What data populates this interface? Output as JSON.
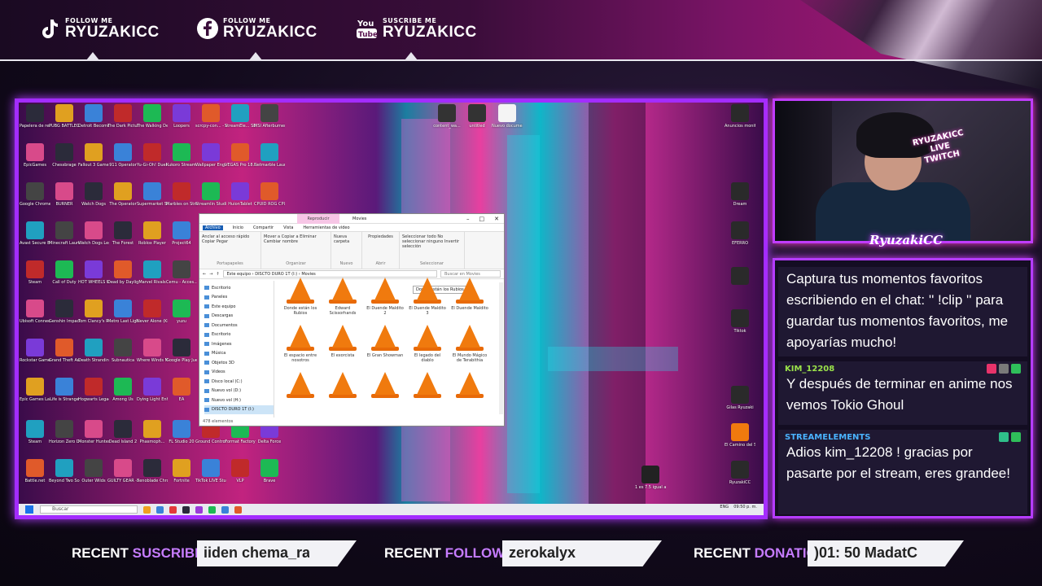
{
  "socials": [
    {
      "icon": "tiktok-icon",
      "label_small": "FOLLOW ME",
      "label_big": "RYUZAKICC"
    },
    {
      "icon": "facebook-icon",
      "label_small": "FOLLOW ME",
      "label_big": "RYUZAKICC"
    },
    {
      "icon": "youtube-icon",
      "label_small": "SUSCRIBE ME",
      "label_big": "RYUZAKICC"
    }
  ],
  "desktop": {
    "icons": [
      "Papelera de reciclaje",
      "PUBG BATTLEGR...",
      "Detroit Become...",
      "The Dark Pictures...",
      "The Walking Dead The...",
      "Loopers",
      "scrcpy-con... - Acceso di...",
      "StreamEle... SE.Live",
      "MSI Afterburner",
      "EpicGames",
      "Chessbrage",
      "Fallout 3 Game of t...",
      "911 Operator",
      "Yu-Gi-Oh! Duel Links",
      "Kukoro Stream ch...",
      "Wallpaper Engine",
      "VEGAS Pro 18.0",
      "Netmarble Launcher",
      "Google Chrome",
      "BURNER",
      "Watch Dogs",
      "The Operator",
      "Supermarket Simulator",
      "Marbles on Stream",
      "Streamlin Studio",
      "HuionTablet",
      "CPUID ROG CPU-Z",
      "Avast Secure Browser",
      "Minecraft Launcher",
      "Watch Dogs Legion",
      "The Forest",
      "Roblox Player",
      "Project64",
      "Steam",
      "Call of Duty",
      "HOT WHEELS UNLEASHED",
      "Dead by Daylight",
      "Marvel Rivals",
      "Cemu - Acces...",
      "Ubisoft Connect",
      "Genshin Impact",
      "Tom Clancy's Rainbow Si...",
      "Metro Last Light Redux",
      "Never Alone (Kisima In...",
      "yuzu",
      "Rockstar Games",
      "Grand Theft Auto V",
      "Death Stranding",
      "Subnautica",
      "Where Winds Meet",
      "Google Play Juegos",
      "Epic Games Launcher",
      "Life is Strange",
      "Hogwarts Legacy",
      "Among Us",
      "Dying Light Enhanced...",
      "EA",
      "Steam",
      "Horizon Zero Dawn",
      "Monster Hunter World",
      "Dead Island 2",
      "Phasmoph...",
      "FL Studio 20",
      "Ground Control",
      "Format Factory",
      "Delta Force",
      "Battle.net",
      "Beyond Two Souls",
      "Outer Wilds",
      "GUILTY GEAR -STRIVE-",
      "Xenoblade Chronicl...",
      "Fortnite",
      "TikTok LIVE Studio",
      "VLP",
      "Brave"
    ],
    "top_icons": [
      "content_wa...",
      "untitled",
      "Nuevo documen..."
    ],
    "right_icons": [
      "Anuncios monitor",
      "Dream",
      "EFERRO",
      "",
      "Tiktok",
      "Gilas Ryuzaki",
      "El Camino del Streamer",
      "RyuzakiCC"
    ],
    "folder_icon": "1 es 7.5 igual a 0.125 d 0...",
    "taskbar": {
      "search_placeholder": "Buscar",
      "lang": "ENG",
      "time": "09:50 p. m."
    }
  },
  "explorer": {
    "contextual_tab": "Reproducir",
    "title": "Movies",
    "tabs": [
      "Archivo",
      "Inicio",
      "Compartir",
      "Vista",
      "Herramientas de video"
    ],
    "ribbon_groups": [
      {
        "buttons": "Anclar al acceso rápido  Copiar  Pegar",
        "label": "Portapapeles"
      },
      {
        "buttons": "Mover a  Copiar a  Eliminar  Cambiar nombre",
        "label": "Organizar"
      },
      {
        "buttons": "Nueva carpeta",
        "label": "Nuevo"
      },
      {
        "buttons": "Propiedades",
        "label": "Abrir"
      },
      {
        "buttons": "Seleccionar todo  No seleccionar ninguno  Invertir selección",
        "label": "Seleccionar"
      }
    ],
    "path": "Este equipo  ›  DISCTO DURO 1T (I:)  ›  Movies",
    "search_placeholder": "Buscar en Movies",
    "nav": [
      "Escritorio",
      "Paneles",
      "Este equipo",
      "Descargas",
      "Documentos",
      "Escritorio",
      "Imágenes",
      "Música",
      "Objetos 3D",
      "Videos",
      "Disco local (C:)",
      "Nuevo vol (D:)",
      "Nuevo vol (H:)",
      "DISCTO DURO 1T (I:)"
    ],
    "files": [
      "Donde están los Rubios",
      "Edward Scissorhands",
      "El Duende Maldito 2",
      "El Duende Maldito 3",
      "El Duende Maldito",
      "El espacio entre nosotros",
      "El exorcista",
      "El Gran Showman",
      "El legado del diablo",
      "El Mundo Mágico de Terabithia",
      "",
      "",
      "",
      "",
      ""
    ],
    "tooltip": "Donde están los Rubios",
    "status": "478 elementos"
  },
  "cam": {
    "sign": "RYUZAKICC LIVE TWITCH",
    "logo": "RyuzakiCC"
  },
  "chat": [
    {
      "name": "",
      "text": "Captura tus momentos favoritos escribiendo en el chat: '' !clip '' para guardar tus momentos favoritos, me apoyarías mucho!"
    },
    {
      "name": "KIM_12208",
      "text": "Y después de terminar en anime nos vemos Tokio Ghoul"
    },
    {
      "name": "STREAMELEMENTS",
      "text": "Adios kim_12208 ! gracias por pasarte por el stream, eres grandee!"
    }
  ],
  "recent": {
    "suscriber": {
      "label_a": "RECENT",
      "label_b": "SUSCRIBER",
      "value": "iiden chema_ra"
    },
    "follower": {
      "label_a": "RECENT",
      "label_b": "FOLLOWER",
      "value": "zerokalyx"
    },
    "donation": {
      "label_a": "RECENT",
      "label_b": "DONATION",
      "value": ")01: 50 MadatC"
    }
  },
  "colors": {
    "accent": "#c13cff",
    "name_green": "#9be34a",
    "name_blue": "#4ab3ff"
  }
}
